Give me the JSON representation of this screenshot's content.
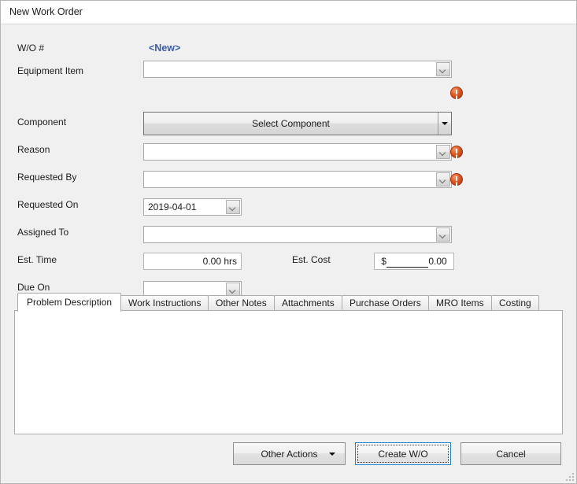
{
  "window": {
    "title": "New Work Order"
  },
  "form": {
    "wo_number": {
      "label": "W/O #",
      "value": "<New>"
    },
    "equipment_item": {
      "label": "Equipment Item",
      "value": "",
      "has_error": true
    },
    "component": {
      "label": "Component",
      "button_label": "Select Component"
    },
    "reason": {
      "label": "Reason",
      "value": "",
      "has_error": true
    },
    "requested_by": {
      "label": "Requested By",
      "value": "",
      "has_error": true
    },
    "requested_on": {
      "label": "Requested On",
      "value": "2019-04-01"
    },
    "assigned_to": {
      "label": "Assigned To",
      "value": ""
    },
    "est_time": {
      "label": "Est. Time",
      "value": "0.00 hrs"
    },
    "est_cost": {
      "label": "Est. Cost",
      "currency_symbol": "$",
      "mask": "________",
      "value": "0.00"
    },
    "due_on": {
      "label": "Due On",
      "value": ""
    }
  },
  "tabs": {
    "items": [
      {
        "label": "Problem Description",
        "active": true
      },
      {
        "label": "Work Instructions",
        "active": false
      },
      {
        "label": "Other Notes",
        "active": false
      },
      {
        "label": "Attachments",
        "active": false
      },
      {
        "label": "Purchase Orders",
        "active": false
      },
      {
        "label": "MRO Items",
        "active": false
      },
      {
        "label": "Costing",
        "active": false
      }
    ],
    "active_panel_text": "",
    "active_panel_placeholder": ""
  },
  "footer": {
    "other_actions": "Other Actions",
    "create_wo": "Create W/O",
    "cancel": "Cancel"
  },
  "colors": {
    "accent_link": "#3b5ca8",
    "error": "#e25a1f",
    "focus": "#1e84d4",
    "panel_bg": "#f0f0f0"
  }
}
